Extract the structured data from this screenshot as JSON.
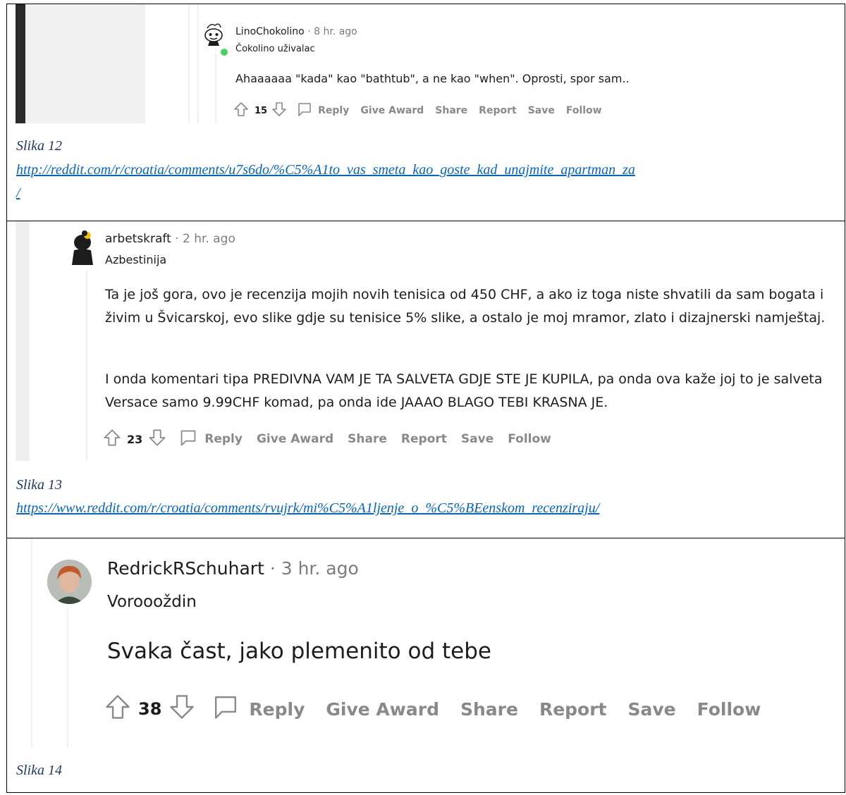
{
  "captions": {
    "c12": "Slika 12",
    "c13": "Slika 13",
    "c14": "Slika 14"
  },
  "links": {
    "l12a": "http://reddit.com/r/croatia/comments/u7s6do/%C5%A1to_vas_smeta_kao_goste_kad_unajmite_apartman_za",
    "l12b": "/",
    "l13": "https://www.reddit.com/r/croatia/comments/rvujrk/mi%C5%A1ljenje_o_%C5%BEenskom_recenziraju/"
  },
  "comments": [
    {
      "username": "LinoChokolino",
      "time": "· 8 hr. ago",
      "flair": "Čokolino uživalac",
      "paragraphs": [
        "Ahaaaaaa \"kada\" kao \"bathtub\", a ne kao \"when\". Oprosti, spor sam..."
      ],
      "score": "15",
      "actions": [
        "Reply",
        "Give Award",
        "Share",
        "Report",
        "Save",
        "Follow"
      ],
      "online": true
    },
    {
      "username": "arbetskraft",
      "time": "· 2 hr. ago",
      "flair": "Azbestinija",
      "paragraphs": [
        "Ta je još gora, ovo je recenzija mojih novih tenisica od 450 CHF, a ako iz toga niste shvatili da sam bogata i živim u Švicarskoj, evo slike gdje su tenisice 5% slike, a ostalo je moj mramor, zlato i dizajnerski namještaj.",
        "I onda komentari tipa PREDIVNA VAM JE TA SALVETA GDJE STE JE KUPILA, pa onda ova kaže joj to je salveta Versace samo 9.99CHF komad, pa onda ide JAAAO BLAGO TEBI KRASNA JE."
      ],
      "score": "23",
      "actions": [
        "Reply",
        "Give Award",
        "Share",
        "Report",
        "Save",
        "Follow"
      ]
    },
    {
      "username": "RedrickRSchuhart",
      "time": "· 3 hr. ago",
      "flair": "Voroooždin",
      "paragraphs": [
        "Svaka čast, jako plemenito od tebe"
      ],
      "score": "38",
      "actions": [
        "Reply",
        "Give Award",
        "Share",
        "Report",
        "Save",
        "Follow"
      ]
    }
  ],
  "colors": {
    "online": "#46d160",
    "caption": "#1f3864",
    "link": "#0563c1",
    "action_gray": "#878a8c"
  },
  "icons": [
    "upvote-icon",
    "downvote-icon",
    "comment-icon",
    "snoo-avatar-icon"
  ]
}
